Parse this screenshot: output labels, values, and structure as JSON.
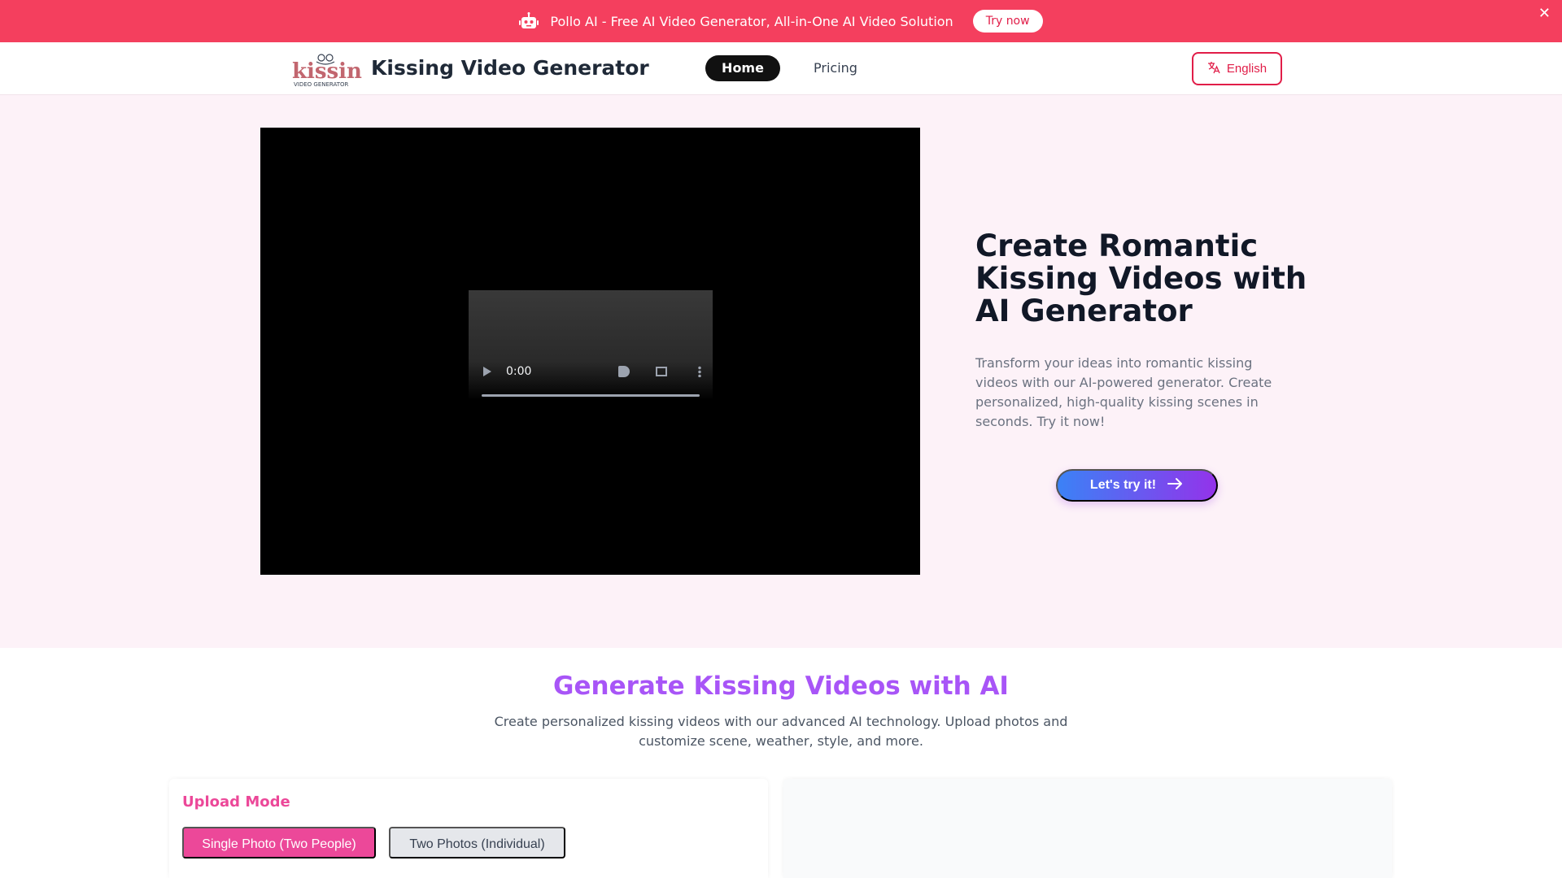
{
  "promo": {
    "icon": "robot-icon",
    "text": "Pollo AI - Free AI Video Generator, All-in-One AI Video Solution",
    "button": "Try now",
    "close": "✕"
  },
  "header": {
    "logo_alt": "kissing VIDEO GENERATOR",
    "title": "Kissing Video Generator",
    "nav": {
      "home": "Home",
      "pricing": "Pricing"
    },
    "language": "English"
  },
  "video": {
    "time": "0:00"
  },
  "hero": {
    "title": "Create Romantic Kissing Videos with AI Generator",
    "description": "Transform your ideas into romantic kissing videos with our AI-powered generator. Create personalized, high-quality kissing scenes in seconds. Try it now!",
    "cta": "Let's try it!"
  },
  "generator": {
    "title": "Generate Kissing Videos with AI",
    "description": "Create personalized kissing videos with our advanced AI technology. Upload photos and customize scene, weather, style, and more.",
    "upload_mode_label": "Upload Mode",
    "modes": [
      "Single Photo (Two People)",
      "Two Photos (Individual)"
    ]
  },
  "colors": {
    "banner": "#f43f5e",
    "accent": "#e11d48",
    "pink": "#ec4899",
    "purple": "#a855f7"
  }
}
